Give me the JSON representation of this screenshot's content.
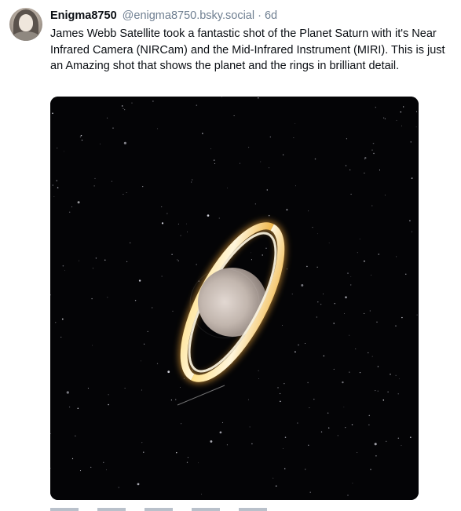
{
  "post": {
    "author": {
      "display_name": "Enigma8750",
      "handle": "@enigma8750.bsky.social",
      "separator": " · ",
      "time": "6d"
    },
    "text": "James Webb Satellite took a fantastic shot of the Planet Saturn with it's Near Infrared Camera (NIRCam) and the Mid-Infrared Instrument (MIRI). This is just an Amazing shot that shows the planet and the rings in brilliant detail.",
    "image": {
      "subject_icon": "saturn-image",
      "background_color": "#040406",
      "ring_color": "#fff1c8",
      "planet_color": "#c8bdb6"
    }
  }
}
